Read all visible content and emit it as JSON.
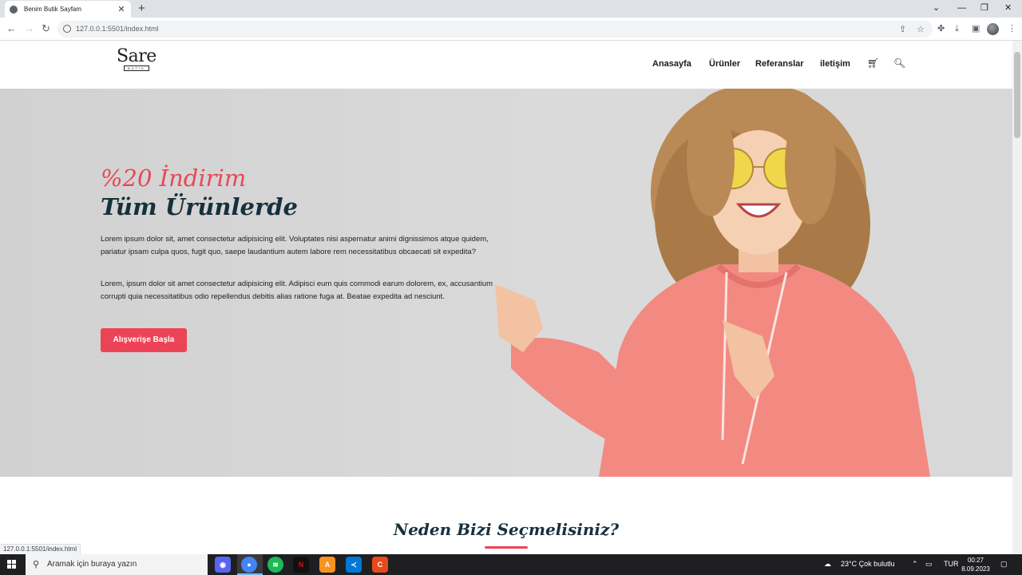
{
  "browser": {
    "tab_title": "Benim Butik Sayfam",
    "url": "127.0.0.1:5501/index.html",
    "status_url": "127.0.0.1:5501/index.html"
  },
  "site": {
    "logo_word": "Sare",
    "logo_sub": "BUTİK",
    "nav": [
      "Anasayfa",
      "Ürünler",
      "Referanslar",
      "iletişim"
    ]
  },
  "hero": {
    "title_line1": "%20 İndirim",
    "title_line2": "Tüm Ürünlerde",
    "paragraph1": "Lorem ipsum dolor sit, amet consectetur adipisicing elit. Voluptates nisi aspernatur animi dignissimos atque quidem, pariatur ipsam culpa quos, fugit quo, saepe laudantium autem labore rem necessitatibus obcaecati sit expedita?",
    "paragraph2": "Lorem, ipsum dolor sit amet consectetur adipisicing elit. Adipisci eum quis commodi earum dolorem, ex, accusantium corrupti quia necessitatibus odio repellendus debitis alias ratione fuga at. Beatae expedita ad nesciunt.",
    "button": "Alışverişe Başla"
  },
  "section": {
    "title": "Neden Bizi Seçmelisiniz?"
  },
  "taskbar": {
    "search_placeholder": "Aramak için buraya yazın",
    "weather": "23°C  Çok bulutlu",
    "lang": "TUR",
    "time": "00:27",
    "date": "8.09.2023"
  },
  "colors": {
    "accent": "#ec4456",
    "dark": "#16303d"
  }
}
